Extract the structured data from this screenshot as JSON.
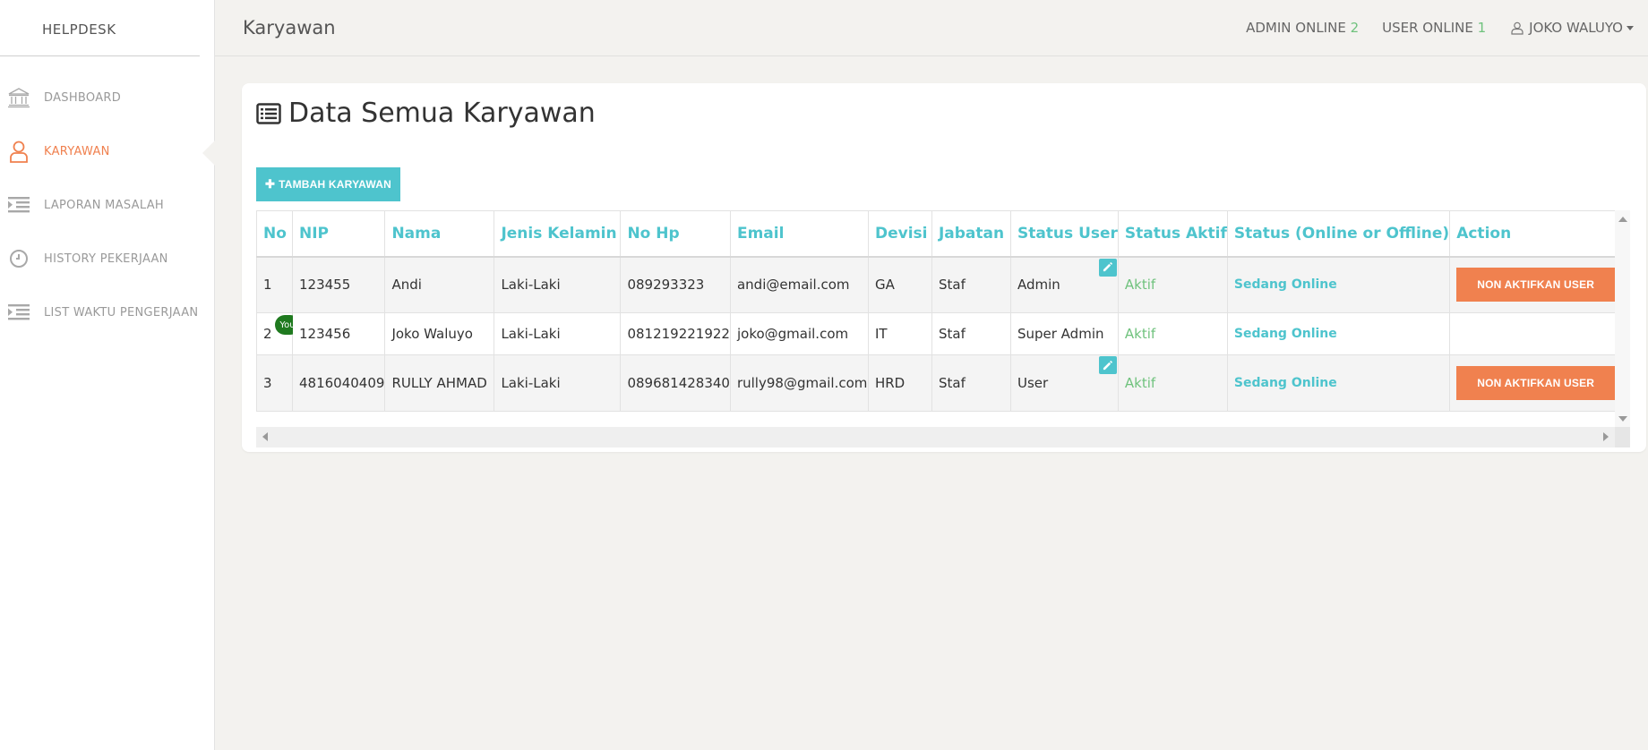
{
  "sidebar": {
    "brand": "HELPDESK",
    "items": [
      {
        "label": "DASHBOARD",
        "icon": "bank-icon",
        "active": false
      },
      {
        "label": "KARYAWAN",
        "icon": "user-icon",
        "active": true
      },
      {
        "label": "LAPORAN MASALAH",
        "icon": "list-indent-icon",
        "active": false
      },
      {
        "label": "HISTORY PEKERJAAN",
        "icon": "clock-icon",
        "active": false
      },
      {
        "label": "LIST WAKTU PENGERJAAN",
        "icon": "list-indent-icon",
        "active": false
      }
    ]
  },
  "topbar": {
    "title": "Karyawan",
    "admin_online_label": "ADMIN ONLINE",
    "admin_online_count": "2",
    "user_online_label": "USER ONLINE",
    "user_online_count": "1",
    "user_name": "JOKO WALUYO"
  },
  "card": {
    "title": "Data Semua Karyawan",
    "add_button": "TAMBAH KARYAWAN"
  },
  "table": {
    "headers": [
      "No",
      "NIP",
      "Nama",
      "Jenis Kelamin",
      "No Hp",
      "Email",
      "Devisi",
      "Jabatan",
      "Status User",
      "Status Aktif",
      "Status (Online or Offline)",
      "Action"
    ],
    "rows": [
      {
        "no": "1",
        "nip": "123455",
        "nama": "Andi",
        "jk": "Laki-Laki",
        "hp": "089293323",
        "email": "andi@email.com",
        "devisi": "GA",
        "jabatan": "Staf",
        "status_user": "Admin",
        "status_aktif": "Aktif",
        "status_online": "Sedang Online",
        "action": "NON AKTIFKAN USER"
      },
      {
        "no": "2",
        "nip": "123456",
        "nama": "Joko Waluyo",
        "jk": "Laki-Laki",
        "hp": "081219221922",
        "email": "joko@gmail.com",
        "devisi": "IT",
        "jabatan": "Staf",
        "status_user": "Super Admin",
        "status_aktif": "Aktif",
        "status_online": "Sedang Online",
        "action": "",
        "badge": "You"
      },
      {
        "no": "3",
        "nip": "4816040409",
        "nama": "RULLY AHMAD",
        "jk": "Laki-Laki",
        "hp": "089681428340",
        "email": "rully98@gmail.com",
        "devisi": "HRD",
        "jabatan": "Staf",
        "status_user": "User",
        "status_aktif": "Aktif",
        "status_online": "Sedang Online",
        "action": "NON AKTIFKAN USER"
      }
    ]
  },
  "colors": {
    "accent_teal": "#4ec4cd",
    "accent_orange": "#f0814f",
    "online_green": "#6fc27d",
    "badge_green": "#1f7a1f"
  }
}
